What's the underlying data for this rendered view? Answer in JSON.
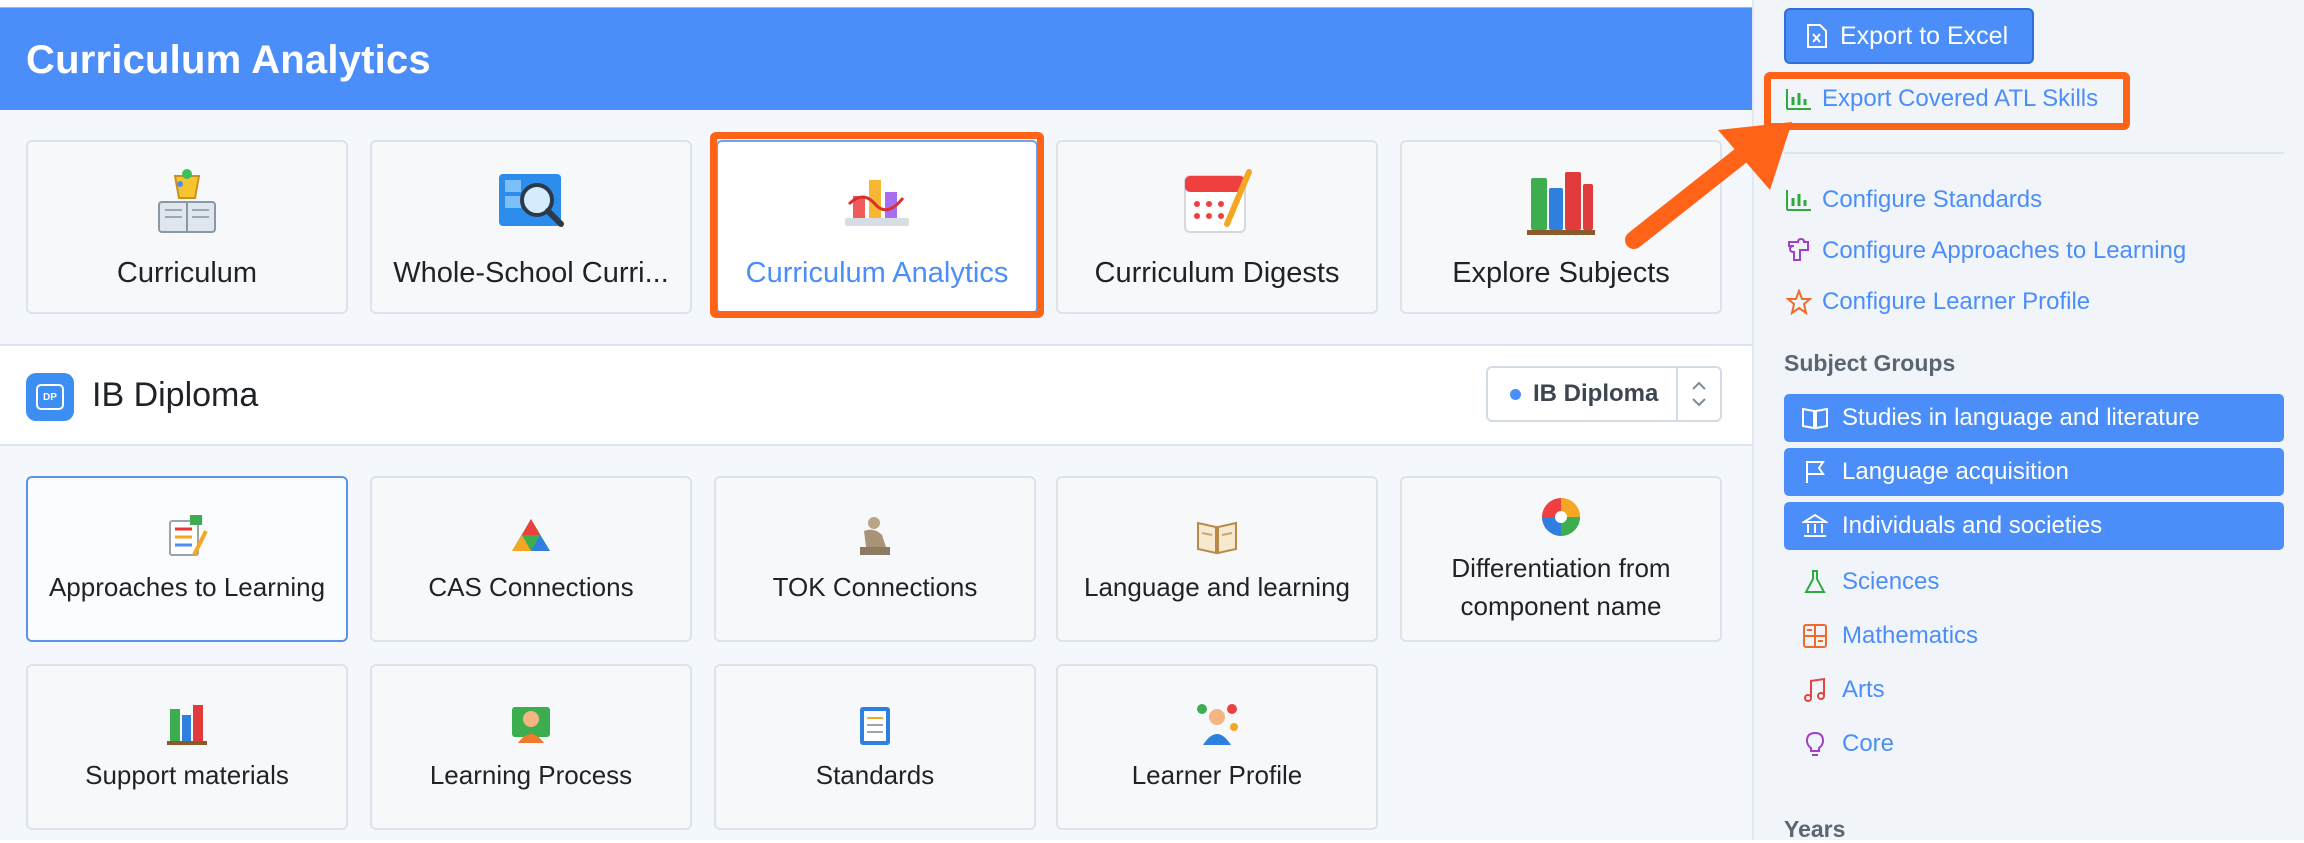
{
  "header": {
    "title": "Curriculum Analytics"
  },
  "top_tiles": [
    {
      "label": "Curriculum",
      "icon": "curriculum-book-icon"
    },
    {
      "label": "Whole-School Curri...",
      "icon": "magnifier-window-icon"
    },
    {
      "label": "Curriculum Analytics",
      "icon": "bar-chart-icon",
      "active": true
    },
    {
      "label": "Curriculum Digests",
      "icon": "calendar-icon"
    },
    {
      "label": "Explore Subjects",
      "icon": "books-icon"
    }
  ],
  "programme": {
    "badge": "DP",
    "title": "IB Diploma",
    "select_value": "IB Diploma"
  },
  "bottom_tiles": [
    {
      "label": "Approaches to Learning",
      "icon": "checklist-pencil-icon",
      "selected": true
    },
    {
      "label": "CAS Connections",
      "icon": "cas-triangle-icon"
    },
    {
      "label": "TOK Connections",
      "icon": "thinker-statue-icon"
    },
    {
      "label": "Language and learning",
      "icon": "open-book-icon"
    },
    {
      "label": "Differentiation from component name",
      "icon": "color-wheel-icon"
    },
    {
      "label": "Support materials",
      "icon": "books-icon"
    },
    {
      "label": "Learning Process",
      "icon": "person-board-icon"
    },
    {
      "label": "Standards",
      "icon": "clipboard-icon"
    },
    {
      "label": "Learner Profile",
      "icon": "learner-person-icon"
    }
  ],
  "sidebar": {
    "export_excel": "Export to Excel",
    "export_atl": "Export Covered ATL Skills",
    "configure": [
      {
        "label": "Configure Standards",
        "icon": "bar-chart-icon",
        "color": "#2eaa3f"
      },
      {
        "label": "Configure Approaches to Learning",
        "icon": "puzzle-icon",
        "color": "#a23fc9"
      },
      {
        "label": "Configure Learner Profile",
        "icon": "star-icon",
        "color": "#f06a2c"
      }
    ],
    "subject_groups_heading": "Subject Groups",
    "subject_groups": [
      {
        "label": "Studies in language and literature",
        "icon": "book-icon",
        "selected": true
      },
      {
        "label": "Language acquisition",
        "icon": "flag-icon",
        "selected": true
      },
      {
        "label": "Individuals and societies",
        "icon": "bank-icon",
        "selected": true
      },
      {
        "label": "Sciences",
        "icon": "flask-icon",
        "selected": false,
        "color": "#2eaa3f"
      },
      {
        "label": "Mathematics",
        "icon": "calculator-icon",
        "selected": false,
        "color": "#f06a2c"
      },
      {
        "label": "Arts",
        "icon": "music-note-icon",
        "selected": false,
        "color": "#e3443f"
      },
      {
        "label": "Core",
        "icon": "lightbulb-icon",
        "selected": false,
        "color": "#a23fc9"
      }
    ],
    "years_heading": "Years"
  },
  "colors": {
    "brand_blue": "#4b8ef9",
    "highlight_orange": "#ff6318"
  }
}
